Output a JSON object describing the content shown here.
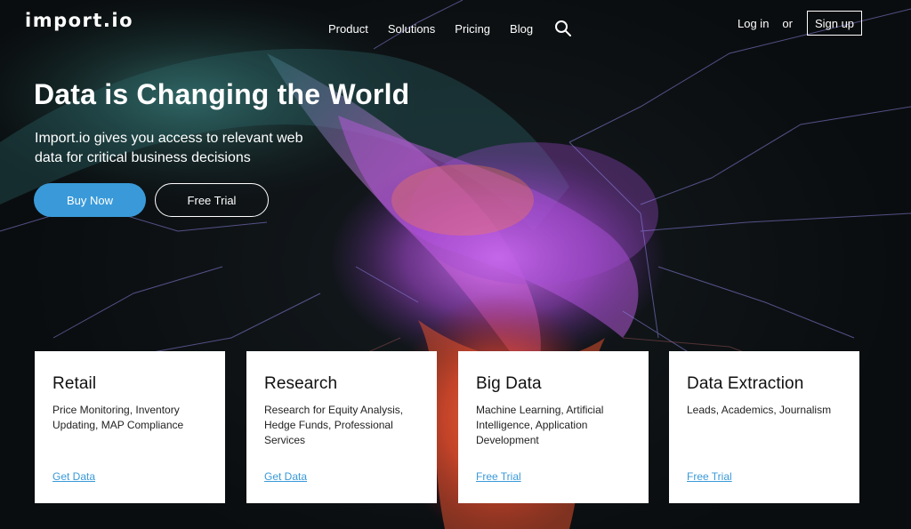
{
  "header": {
    "logo": "import.io",
    "nav": [
      "Product",
      "Solutions",
      "Pricing",
      "Blog"
    ],
    "search_icon": "search-icon",
    "login": "Log in",
    "or": "or",
    "signup": "Sign up"
  },
  "hero": {
    "title": "Data is Changing the World",
    "subtitle": "Import.io gives you access to relevant web data for critical business decisions",
    "buy_label": "Buy Now",
    "trial_label": "Free Trial"
  },
  "cards": [
    {
      "title": "Retail",
      "desc": "Price Monitoring, Inventory Updating, MAP Compliance",
      "link": "Get Data"
    },
    {
      "title": "Research",
      "desc": "Research for Equity Analysis, Hedge Funds, Professional Services",
      "link": "Get Data"
    },
    {
      "title": "Big Data",
      "desc": "Machine Learning, Artificial Intelligence, Application Development",
      "link": "Free Trial"
    },
    {
      "title": "Data Extraction",
      "desc": "Leads, Academics, Journalism",
      "link": "Free Trial"
    }
  ],
  "colors": {
    "accent": "#3a9ad9",
    "background": "#0b0f10",
    "card": "#ffffff"
  }
}
